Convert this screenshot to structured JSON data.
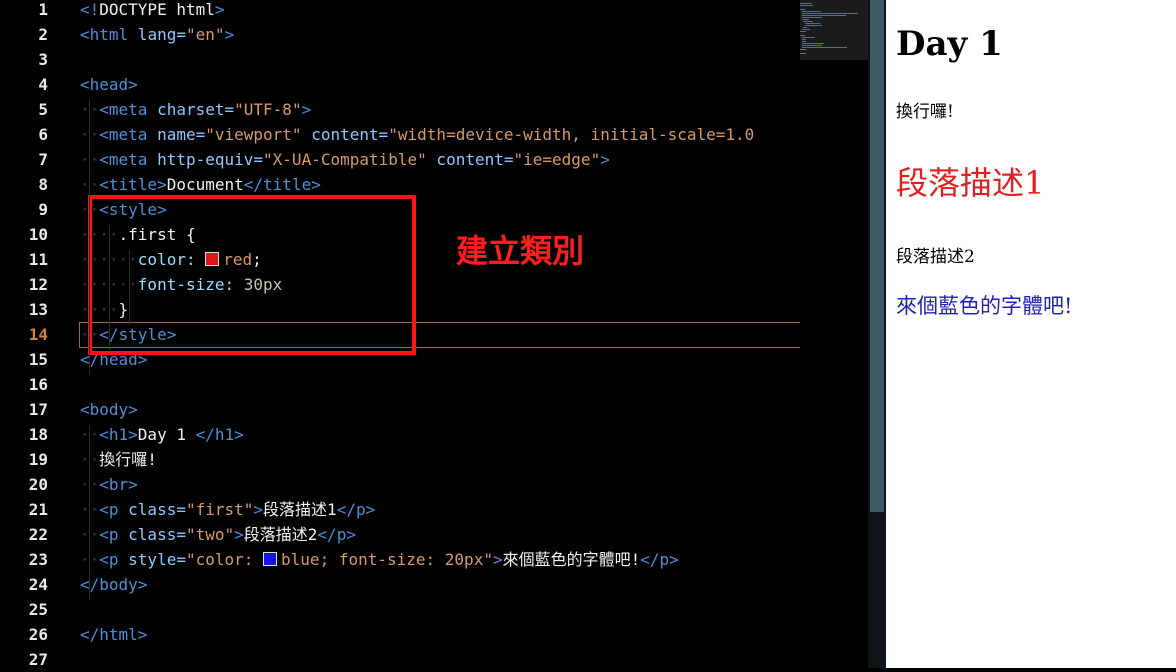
{
  "editor": {
    "lines": [
      {
        "n": "1",
        "ws": "",
        "parts": [
          {
            "c": "t",
            "v": "<!"
          },
          {
            "c": "x",
            "v": "DOCTYPE html"
          },
          {
            "c": "t",
            "v": ">"
          }
        ]
      },
      {
        "n": "2",
        "ws": "",
        "parts": [
          {
            "c": "t",
            "v": "<html"
          },
          {
            "c": "a",
            "v": " lang="
          },
          {
            "c": "s",
            "v": "\"en\""
          },
          {
            "c": "t",
            "v": ">"
          }
        ]
      },
      {
        "n": "3",
        "ws": "",
        "parts": []
      },
      {
        "n": "4",
        "ws": "",
        "parts": [
          {
            "c": "t",
            "v": "<head>"
          }
        ]
      },
      {
        "n": "5",
        "ws": "··",
        "parts": [
          {
            "c": "t",
            "v": "<meta"
          },
          {
            "c": "a",
            "v": " charset="
          },
          {
            "c": "s",
            "v": "\"UTF-8\""
          },
          {
            "c": "t",
            "v": ">"
          }
        ]
      },
      {
        "n": "6",
        "ws": "··",
        "parts": [
          {
            "c": "t",
            "v": "<meta"
          },
          {
            "c": "a",
            "v": " name="
          },
          {
            "c": "s",
            "v": "\"viewport\""
          },
          {
            "c": "a",
            "v": " content="
          },
          {
            "c": "s",
            "v": "\"width=device-width, initial-scale=1.0"
          }
        ]
      },
      {
        "n": "7",
        "ws": "··",
        "parts": [
          {
            "c": "t",
            "v": "<meta"
          },
          {
            "c": "a",
            "v": " http-equiv="
          },
          {
            "c": "s",
            "v": "\"X-UA-Compatible\""
          },
          {
            "c": "a",
            "v": " content="
          },
          {
            "c": "s",
            "v": "\"ie=edge\""
          },
          {
            "c": "t",
            "v": ">"
          }
        ]
      },
      {
        "n": "8",
        "ws": "··",
        "parts": [
          {
            "c": "t",
            "v": "<title>"
          },
          {
            "c": "x",
            "v": "Document"
          },
          {
            "c": "t",
            "v": "</title>"
          }
        ]
      },
      {
        "n": "9",
        "ws": "··",
        "parts": [
          {
            "c": "t",
            "v": "<style>"
          }
        ]
      },
      {
        "n": "10",
        "ws": "····",
        "parts": [
          {
            "c": "x",
            "v": ".first {"
          }
        ]
      },
      {
        "n": "11",
        "ws": "······",
        "parts": [
          {
            "c": "cssp",
            "v": "color: "
          },
          {
            "c": "swatch",
            "v": "#e01515"
          },
          {
            "c": "cssv",
            "v": "red"
          },
          {
            "c": "x",
            "v": ";"
          }
        ]
      },
      {
        "n": "12",
        "ws": "······",
        "parts": [
          {
            "c": "cssp",
            "v": "font-size: "
          },
          {
            "c": "num",
            "v": "30px"
          }
        ]
      },
      {
        "n": "13",
        "ws": "····",
        "parts": [
          {
            "c": "x",
            "v": "}"
          }
        ]
      },
      {
        "n": "14",
        "ws": "··",
        "parts": [
          {
            "c": "t",
            "v": "</style>"
          }
        ]
      },
      {
        "n": "15",
        "ws": "",
        "parts": [
          {
            "c": "t",
            "v": "</head>"
          }
        ]
      },
      {
        "n": "16",
        "ws": "",
        "parts": []
      },
      {
        "n": "17",
        "ws": "",
        "parts": [
          {
            "c": "t",
            "v": "<body>"
          }
        ]
      },
      {
        "n": "18",
        "ws": "··",
        "parts": [
          {
            "c": "t",
            "v": "<h1>"
          },
          {
            "c": "x",
            "v": "Day 1 "
          },
          {
            "c": "t",
            "v": "</h1>"
          }
        ]
      },
      {
        "n": "19",
        "ws": "··",
        "parts": [
          {
            "c": "x",
            "v": "換行囉!"
          }
        ]
      },
      {
        "n": "20",
        "ws": "··",
        "parts": [
          {
            "c": "t",
            "v": "<br>"
          }
        ]
      },
      {
        "n": "21",
        "ws": "··",
        "parts": [
          {
            "c": "t",
            "v": "<p"
          },
          {
            "c": "a",
            "v": " class="
          },
          {
            "c": "s",
            "v": "\"first\""
          },
          {
            "c": "t",
            "v": ">"
          },
          {
            "c": "x",
            "v": "段落描述1"
          },
          {
            "c": "t",
            "v": "</p>"
          }
        ]
      },
      {
        "n": "22",
        "ws": "··",
        "parts": [
          {
            "c": "t",
            "v": "<p"
          },
          {
            "c": "a",
            "v": " class="
          },
          {
            "c": "s",
            "v": "\"two\""
          },
          {
            "c": "t",
            "v": ">"
          },
          {
            "c": "x",
            "v": "段落描述2"
          },
          {
            "c": "t",
            "v": "</p>"
          }
        ]
      },
      {
        "n": "23",
        "ws": "··",
        "parts": [
          {
            "c": "t",
            "v": "<p"
          },
          {
            "c": "a",
            "v": " style="
          },
          {
            "c": "s",
            "v": "\"color: "
          },
          {
            "c": "swatch",
            "v": "#1515e0"
          },
          {
            "c": "s",
            "v": "blue; font-size: 20px\""
          },
          {
            "c": "t",
            "v": ">"
          },
          {
            "c": "x",
            "v": "來個藍色的字體吧!"
          },
          {
            "c": "t",
            "v": "</p>"
          }
        ]
      },
      {
        "n": "24",
        "ws": "",
        "parts": [
          {
            "c": "t",
            "v": "</body>"
          }
        ]
      },
      {
        "n": "25",
        "ws": "",
        "parts": []
      },
      {
        "n": "26",
        "ws": "",
        "parts": [
          {
            "c": "t",
            "v": "</html>"
          }
        ]
      },
      {
        "n": "27",
        "ws": "",
        "parts": []
      }
    ],
    "current_line": "14",
    "annotation": "建立類別",
    "colors": {
      "annotation": "#ff1e1e",
      "current_line_number": "#d08040"
    }
  },
  "preview": {
    "h1": "Day 1",
    "text": "換行囉!",
    "p_first": "段落描述1",
    "p_two": "段落描述2",
    "p_blue": "來個藍色的字體吧!",
    "colors": {
      "first": "#e02020",
      "blue": "#2222aa"
    }
  }
}
